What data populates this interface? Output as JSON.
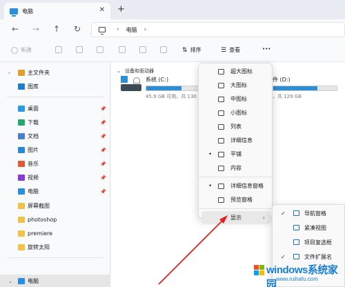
{
  "tab": {
    "title": "电脑",
    "close": "✕",
    "new_tab": "+"
  },
  "address": {
    "segment": "电脑",
    "separator": "›"
  },
  "nav": {
    "back": "←",
    "forward": "→",
    "up": "↑",
    "refresh": "↻"
  },
  "commands": {
    "new_label": "新建",
    "sort_label": "排序",
    "view_label": "查看",
    "more": "•••"
  },
  "sidebar": {
    "top": [
      {
        "label": "主文件夹",
        "icon": "home-icon",
        "color": "#e0a030"
      },
      {
        "label": "图库",
        "icon": "gallery-icon",
        "color": "#1e7fd0"
      }
    ],
    "pinned": [
      {
        "label": "桌面",
        "icon": "desktop-icon",
        "color": "#2a9be0"
      },
      {
        "label": "下载",
        "icon": "download-icon",
        "color": "#27a66c"
      },
      {
        "label": "文档",
        "icon": "documents-icon",
        "color": "#4a7fd0"
      },
      {
        "label": "图片",
        "icon": "pictures-icon",
        "color": "#2b88d8"
      },
      {
        "label": "音乐",
        "icon": "music-icon",
        "color": "#e05a3a"
      },
      {
        "label": "视频",
        "icon": "videos-icon",
        "color": "#8a3ad0"
      },
      {
        "label": "电脑",
        "icon": "computer-icon",
        "color": "#2a8fd8"
      }
    ],
    "folders": [
      {
        "label": "屏幕截图",
        "icon": "folder-icon",
        "color": "#f2c14a"
      },
      {
        "label": "photoshop",
        "icon": "folder-icon",
        "color": "#f2c14a"
      },
      {
        "label": "premiere",
        "icon": "folder-icon",
        "color": "#f2c14a"
      },
      {
        "label": "旋转太阳",
        "icon": "folder-icon",
        "color": "#f2c14a"
      }
    ],
    "bottom": {
      "label": "电脑",
      "icon": "computer-icon"
    }
  },
  "content": {
    "group_label": "设备和驱动器",
    "drives": [
      {
        "name": "系统 (C:)",
        "detail": "45.9 GB 可用，共 130",
        "used_fraction": 0.65
      },
      {
        "name": "件 (D:)",
        "detail": "，共 129 GB",
        "used_fraction": 0.7
      }
    ]
  },
  "view_menu": {
    "items": [
      {
        "label": "超大图标",
        "icon": "extra-large-icons-icon"
      },
      {
        "label": "大图标",
        "icon": "large-icons-icon"
      },
      {
        "label": "中图标",
        "icon": "medium-icons-icon"
      },
      {
        "label": "小图标",
        "icon": "small-icons-icon"
      },
      {
        "label": "列表",
        "icon": "list-icon"
      },
      {
        "label": "详细信息",
        "icon": "details-icon"
      },
      {
        "label": "平铺",
        "icon": "tiles-icon",
        "selected": true
      },
      {
        "label": "内容",
        "icon": "content-icon"
      }
    ],
    "panes": [
      {
        "label": "详细信息窗格",
        "icon": "details-pane-icon",
        "selected": true
      },
      {
        "label": "预览窗格",
        "icon": "preview-pane-icon"
      }
    ],
    "show": {
      "label": "显示",
      "arrow": "›"
    },
    "bullet": "•"
  },
  "show_submenu": {
    "items": [
      {
        "label": "导航窗格",
        "icon": "navigation-pane-icon",
        "checked": true
      },
      {
        "label": "紧凑视图",
        "icon": "compact-view-icon",
        "checked": false
      },
      {
        "label": "项目复选框",
        "icon": "item-checkbox-icon",
        "checked": false
      },
      {
        "label": "文件扩展名",
        "icon": "file-extension-icon",
        "checked": true
      }
    ],
    "check": "✓"
  },
  "watermark": {
    "brand": "windows系统家园",
    "url": "www.ruihafu.com"
  },
  "colors": {
    "accent": "#2b8ed6",
    "arrow": "#e02020"
  }
}
